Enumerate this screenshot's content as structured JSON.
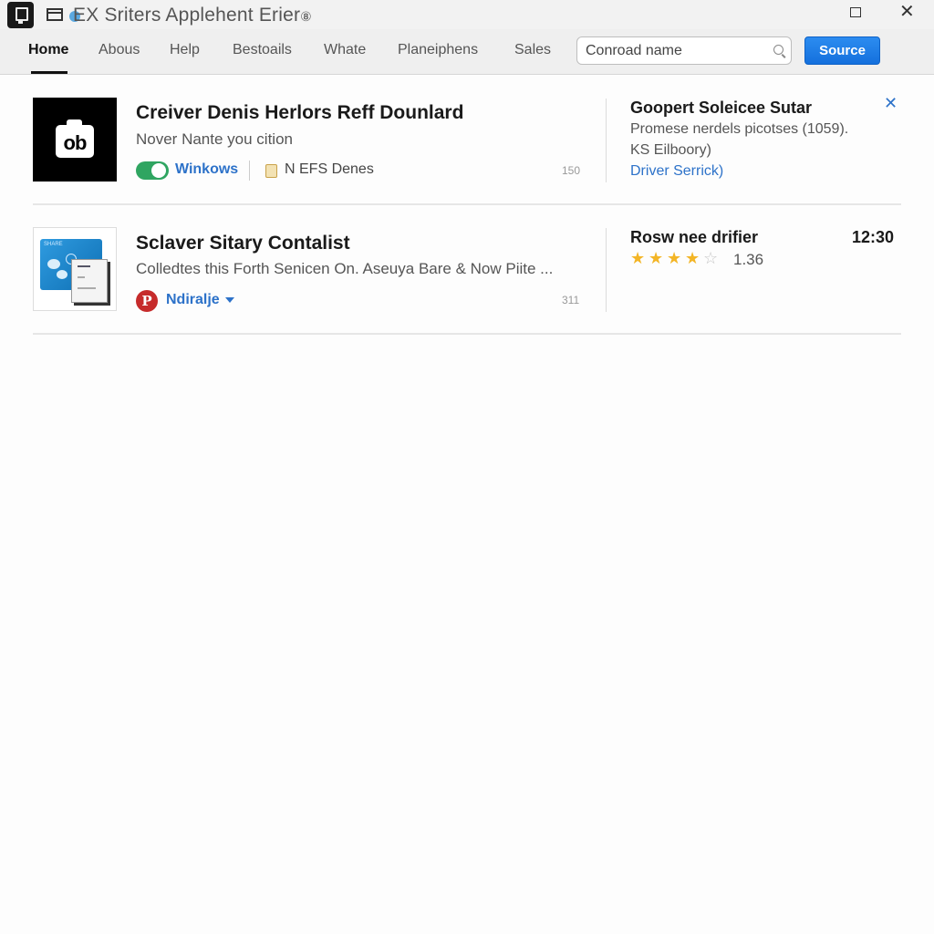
{
  "window": {
    "title": "EX Sriters Applehent Erier",
    "title_suffix_glyph": "⑧",
    "maximize_icon": "maximize-icon",
    "close_glyph": "✕"
  },
  "nav": {
    "tabs": [
      {
        "label": "Home",
        "active": true
      },
      {
        "label": "Abous"
      },
      {
        "label": "Help"
      },
      {
        "label": "Bestoails"
      },
      {
        "label": "Whate"
      },
      {
        "label": "Planeiphens"
      },
      {
        "label": "Sales"
      }
    ],
    "search": {
      "value": "",
      "placeholder": "Conroad name"
    },
    "source_button": "Source"
  },
  "results": [
    {
      "thumb_icon": "camera-icon",
      "thumb_text": "ob",
      "title": "Creiver Denis Herlors Reff Dounlard",
      "subtitle": "Nover Nante you cition",
      "toggle_on": true,
      "meta_link": "Winkows",
      "meta_icon": "folder-icon",
      "meta_text": "N EFS Denes",
      "count": "150",
      "side": {
        "title": "Goopert Soleicee Sutar",
        "line1": "Promese nerdels picotses (1059).",
        "line2": "KS Eilboory)",
        "link": "Driver Serrick)",
        "close_glyph": "✕"
      }
    },
    {
      "thumb_icon": "software-box-icon",
      "thumb_label": "SHARE",
      "title": "Sclaver Sitary Contalist",
      "subtitle": "Colledtes this Forth Senicen On. Aseuya Bare & Now Piite ...",
      "meta_icon": "pinterest-icon",
      "meta_icon_glyph": "P",
      "meta_link": "Ndiralje",
      "count": "311",
      "side": {
        "title": "Rosw nee drifier",
        "time": "12:30",
        "rating": 4,
        "rating_max": 5,
        "rating_value": "1.36"
      }
    }
  ],
  "glyphs": {
    "star": "★",
    "star_empty": "☆"
  }
}
